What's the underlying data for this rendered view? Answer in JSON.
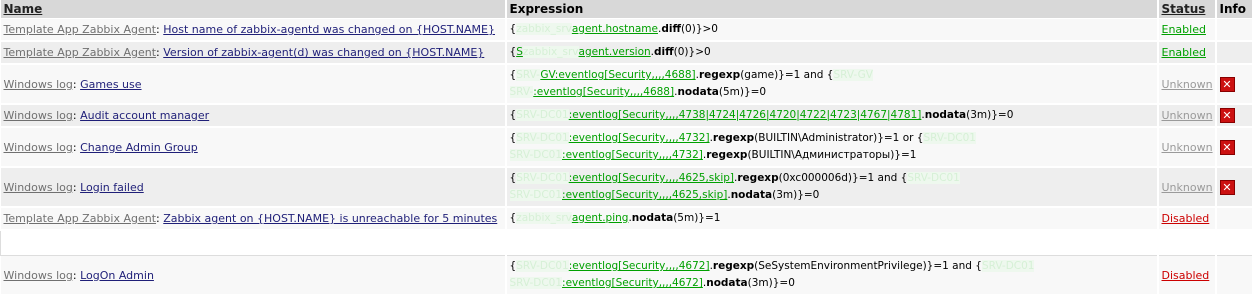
{
  "headers": {
    "name": "Name",
    "expression": "Expression",
    "status": "Status",
    "info": "Info"
  },
  "rows": [
    {
      "host": "Template App Zabbix Agent",
      "trigger": "Host name of zabbix-agentd was changed on {HOST.NAME}",
      "expr": [
        [
          "p",
          "{"
        ],
        [
          "b",
          "zabbix_srv"
        ],
        [
          "g",
          "agent.hostname"
        ],
        [
          "p",
          "."
        ],
        [
          "f",
          "diff"
        ],
        [
          "p",
          "(0)}>0"
        ]
      ],
      "status": "Enabled",
      "status_class": "st-en",
      "error": false
    },
    {
      "host": "Template App Zabbix Agent",
      "trigger": "Version of zabbix-agent(d) was changed on {HOST.NAME}",
      "expr": [
        [
          "p",
          "{"
        ],
        [
          "g",
          "S"
        ],
        [
          "b",
          "zabbix_srv"
        ],
        [
          "g",
          "agent.version"
        ],
        [
          "p",
          "."
        ],
        [
          "f",
          "diff"
        ],
        [
          "p",
          "(0)}>0"
        ]
      ],
      "status": "Enabled",
      "status_class": "st-en",
      "error": false
    },
    {
      "host": "Windows log",
      "trigger": "Games use",
      "expr": [
        [
          "p",
          "{"
        ],
        [
          "b",
          "SRV-"
        ],
        [
          "g",
          "GV:eventlog[Security,,,,4688]"
        ],
        [
          "p",
          "."
        ],
        [
          "f",
          "regexp"
        ],
        [
          "p",
          "(game)}=1 and {"
        ],
        [
          "b",
          "SRV-GV"
        ],
        [
          "br",
          ""
        ],
        [
          "b",
          "SRV-"
        ],
        [
          "g",
          ":eventlog[Security,,,,4688]"
        ],
        [
          "p",
          "."
        ],
        [
          "f",
          "nodata"
        ],
        [
          "p",
          "(5m)}=0"
        ]
      ],
      "status": "Unknown",
      "status_class": "st-unk",
      "error": true
    },
    {
      "host": "Windows log",
      "trigger": "Audit account manager",
      "expr": [
        [
          "p",
          "{"
        ],
        [
          "b",
          "SRV-DC01"
        ],
        [
          "g",
          ":eventlog[Security,,,,4738|4724|4726|4720|4722|4723|4767|4781]"
        ],
        [
          "p",
          "."
        ],
        [
          "f",
          "nodata"
        ],
        [
          "p",
          "(3m)}=0"
        ]
      ],
      "status": "Unknown",
      "status_class": "st-unk",
      "error": true
    },
    {
      "host": "Windows log",
      "trigger": "Change Admin Group",
      "expr": [
        [
          "p",
          "{"
        ],
        [
          "b",
          "SRV-DC01"
        ],
        [
          "g",
          ":eventlog[Security,,,,4732]"
        ],
        [
          "p",
          "."
        ],
        [
          "f",
          "regexp"
        ],
        [
          "p",
          "(BUILTIN\\Administrator)}=1 or {"
        ],
        [
          "b",
          "SRV-DC01"
        ],
        [
          "br",
          ""
        ],
        [
          "b",
          "SRV-DC01"
        ],
        [
          "g",
          ":eventlog[Security,,,,4732]"
        ],
        [
          "p",
          "."
        ],
        [
          "f",
          "regexp"
        ],
        [
          "p",
          "(BUILTIN\\Администраторы)}=1"
        ]
      ],
      "status": "Unknown",
      "status_class": "st-unk",
      "error": true
    },
    {
      "host": "Windows log",
      "trigger": "Login failed",
      "expr": [
        [
          "p",
          "{"
        ],
        [
          "b",
          "SRV-DC01"
        ],
        [
          "g",
          ":eventlog[Security,,,,4625,skip]"
        ],
        [
          "p",
          "."
        ],
        [
          "f",
          "regexp"
        ],
        [
          "p",
          "(0xc000006d)}=1 and {"
        ],
        [
          "b",
          "SRV-DC01"
        ],
        [
          "br",
          ""
        ],
        [
          "b",
          "SRV-DC01"
        ],
        [
          "g",
          ":eventlog[Security,,,,4625,skip]"
        ],
        [
          "p",
          "."
        ],
        [
          "f",
          "nodata"
        ],
        [
          "p",
          "(3m)}=0"
        ]
      ],
      "status": "Unknown",
      "status_class": "st-unk",
      "error": true
    },
    {
      "host": "Template App Zabbix Agent",
      "trigger": "Zabbix agent on {HOST.NAME} is unreachable for 5 minutes",
      "expr": [
        [
          "p",
          "{"
        ],
        [
          "b",
          "zabbix_srv"
        ],
        [
          "g",
          "agent.ping"
        ],
        [
          "p",
          "."
        ],
        [
          "f",
          "nodata"
        ],
        [
          "p",
          "(5m)}=1"
        ]
      ],
      "status": "Disabled",
      "status_class": "st-dis",
      "error": false
    },
    {
      "blank": true
    },
    {
      "host": "Windows log",
      "trigger": "LogOn Admin",
      "expr": [
        [
          "p",
          "{"
        ],
        [
          "b",
          "SRV-DC01"
        ],
        [
          "g",
          ":eventlog[Security,,,,4672]"
        ],
        [
          "p",
          "."
        ],
        [
          "f",
          "regexp"
        ],
        [
          "p",
          "(SeSystemEnvironmentPrivilege)}=1 and {"
        ],
        [
          "b",
          "SRV-DC01"
        ],
        [
          "br",
          ""
        ],
        [
          "b",
          "SRV-DC01"
        ],
        [
          "g",
          ":eventlog[Security,,,,4672]"
        ],
        [
          "p",
          "."
        ],
        [
          "f",
          "nodata"
        ],
        [
          "p",
          "(3m)}=0"
        ]
      ],
      "status": "Disabled",
      "status_class": "st-dis",
      "error": false
    }
  ],
  "icons": {
    "error": "error-x-icon",
    "error_glyph": "✕"
  }
}
